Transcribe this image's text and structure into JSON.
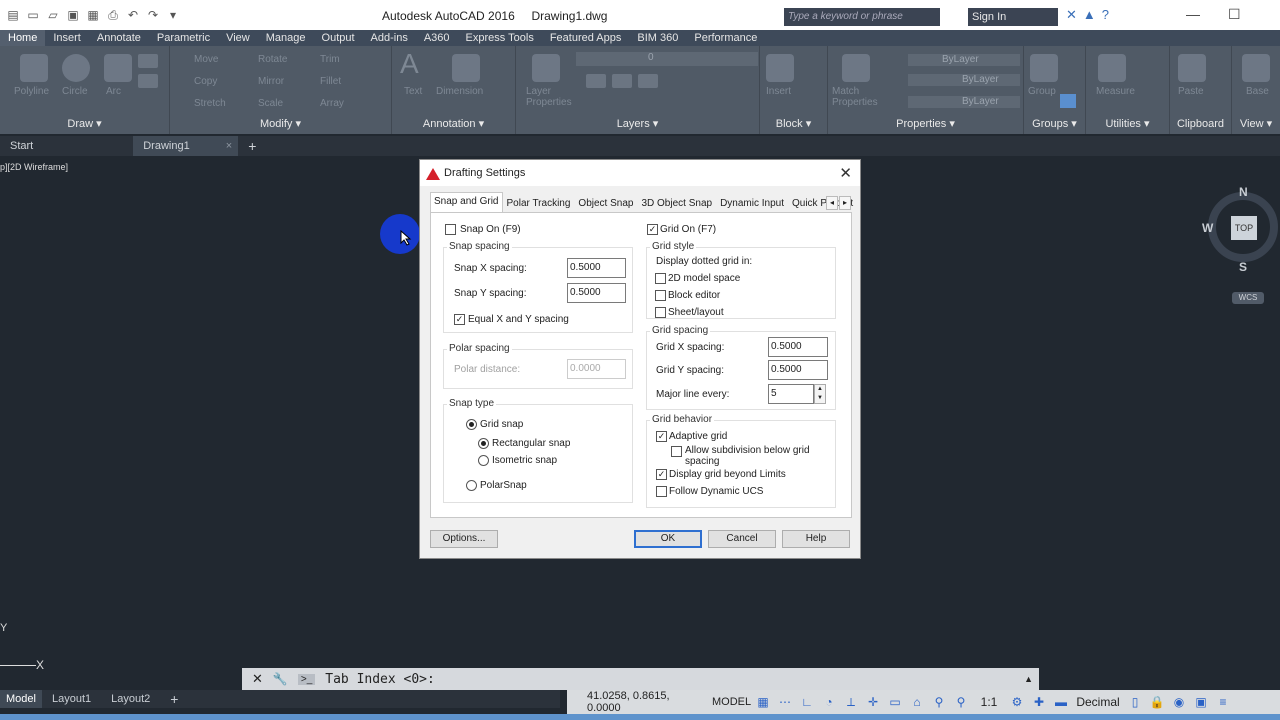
{
  "app": {
    "title": "Autodesk AutoCAD 2016",
    "document": "Drawing1.dwg",
    "search_placeholder": "Type a keyword or phrase",
    "sign_in": "Sign In"
  },
  "ribbon_tabs": [
    "Home",
    "Insert",
    "Annotate",
    "Parametric",
    "View",
    "Manage",
    "Output",
    "Add-ins",
    "A360",
    "Express Tools",
    "Featured Apps",
    "BIM 360",
    "Performance"
  ],
  "ribbon": {
    "panels": {
      "draw": "Draw",
      "modify": "Modify",
      "annotation": "Annotation",
      "layers": "Layers",
      "block": "Block",
      "properties": "Properties",
      "groups": "Groups",
      "utilities": "Utilities",
      "clipboard": "Clipboard",
      "view": "View"
    },
    "draw_tools": [
      "Polyline",
      "Circle",
      "Arc"
    ],
    "modify_tools": [
      "Move",
      "Copy",
      "Stretch",
      "Rotate",
      "Mirror",
      "Scale",
      "Trim",
      "Fillet",
      "Array"
    ],
    "annotation_tools": [
      "Text",
      "Dimension"
    ],
    "layer_tools": [
      "Layer Properties"
    ],
    "layer_value": "0",
    "block_tools": [
      "Insert"
    ],
    "properties_tools": [
      "Match Properties"
    ],
    "property_values": [
      "ByLayer",
      "ByLayer",
      "ByLayer"
    ],
    "groups_tools": [
      "Group"
    ],
    "utilities_tools": [
      "Measure"
    ],
    "clipboard_tools": [
      "Paste"
    ],
    "view_tools": [
      "Base"
    ]
  },
  "doc_tabs": {
    "start": "Start",
    "drawing": "Drawing1"
  },
  "viewport_label": "p][2D Wireframe]",
  "viewcube": {
    "top": "TOP",
    "n": "N",
    "w": "W",
    "s": "S",
    "wcs": "WCS"
  },
  "ucs": {
    "y": "Y",
    "x": "X"
  },
  "command_line": "Tab Index <0>:",
  "layout_tabs": [
    "Model",
    "Layout1",
    "Layout2"
  ],
  "status": {
    "coords": "41.0258, 0.8615, 0.0000",
    "space": "MODEL",
    "scale": "1:1",
    "units": "Decimal"
  },
  "dialog": {
    "title": "Drafting Settings",
    "tabs": [
      "Snap and Grid",
      "Polar Tracking",
      "Object Snap",
      "3D Object Snap",
      "Dynamic Input",
      "Quick Propert"
    ],
    "snap_on": {
      "label": "Snap On (F9)",
      "checked": false
    },
    "grid_on": {
      "label": "Grid On (F7)",
      "checked": true
    },
    "snap_spacing": {
      "title": "Snap spacing",
      "x_label": "Snap X spacing:",
      "x_value": "0.5000",
      "y_label": "Snap Y spacing:",
      "y_value": "0.5000",
      "equal_label": "Equal X and Y spacing",
      "equal_checked": true
    },
    "polar_spacing": {
      "title": "Polar spacing",
      "distance_label": "Polar distance:",
      "distance_value": "0.0000"
    },
    "snap_type": {
      "title": "Snap type",
      "grid_snap": "Grid snap",
      "rectangular": "Rectangular snap",
      "isometric": "Isometric snap",
      "polar": "PolarSnap",
      "selected": "Grid snap / Rectangular snap"
    },
    "grid_style": {
      "title": "Grid style",
      "subtitle": "Display dotted grid in:",
      "options": [
        "2D model space",
        "Block editor",
        "Sheet/layout"
      ]
    },
    "grid_spacing": {
      "title": "Grid spacing",
      "x_label": "Grid X spacing:",
      "x_value": "0.5000",
      "y_label": "Grid Y spacing:",
      "y_value": "0.5000",
      "major_label": "Major line every:",
      "major_value": "5"
    },
    "grid_behavior": {
      "title": "Grid behavior",
      "adaptive": "Adaptive grid",
      "subdivision": "Allow subdivision below grid",
      "subdivision2": "spacing",
      "beyond": "Display grid beyond Limits",
      "follow_ucs": "Follow Dynamic UCS"
    },
    "buttons": {
      "options": "Options...",
      "ok": "OK",
      "cancel": "Cancel",
      "help": "Help"
    }
  },
  "colors": {
    "accent": "#2e6fd0",
    "canvas": "#212830",
    "ribbon": "#505a66"
  }
}
